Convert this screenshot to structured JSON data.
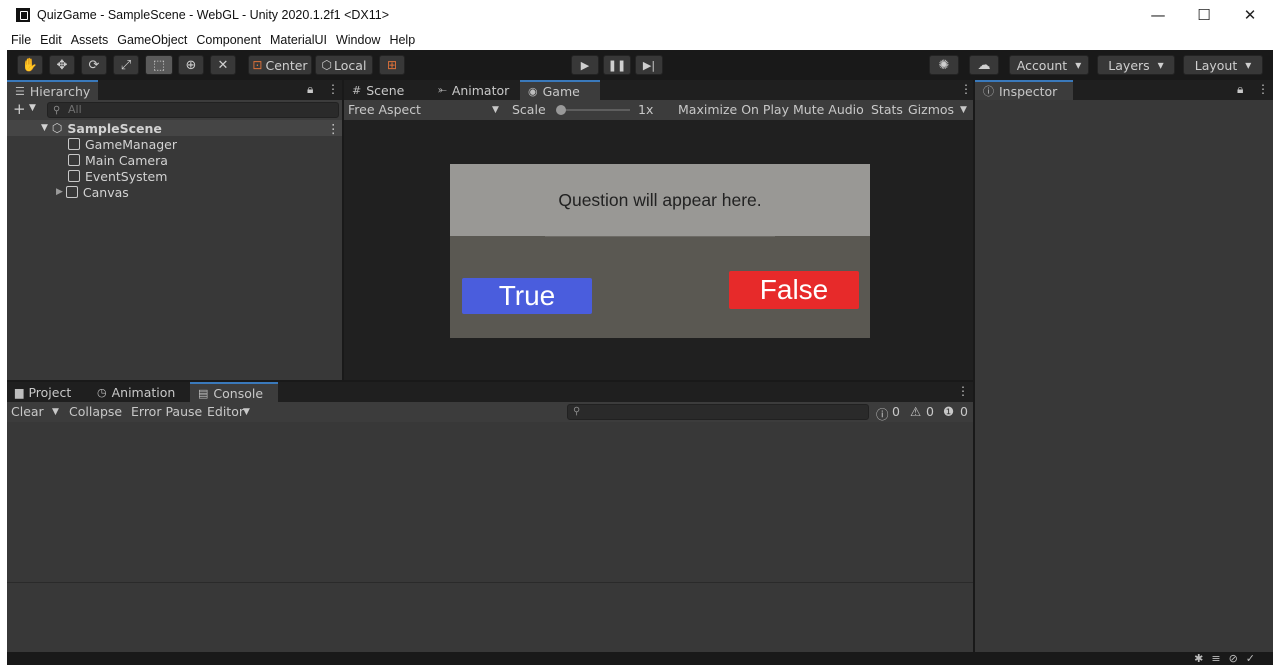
{
  "window": {
    "title": "QuizGame - SampleScene - WebGL - Unity 2020.1.2f1 <DX11>",
    "minimize": "—",
    "maximize": "☐",
    "close": "✕"
  },
  "menu": [
    "File",
    "Edit",
    "Assets",
    "GameObject",
    "Component",
    "MaterialUI",
    "Window",
    "Help"
  ],
  "toolbar": {
    "pivot": "Center",
    "space": "Local",
    "account": "Account",
    "layers": "Layers",
    "layout": "Layout"
  },
  "hierarchy": {
    "title": "Hierarchy",
    "search_placeholder": "All",
    "scene": "SampleScene",
    "items": [
      "GameManager",
      "Main Camera",
      "EventSystem",
      "Canvas"
    ]
  },
  "center_tabs": [
    "Scene",
    "Animator",
    "Game"
  ],
  "game_toolbar": {
    "aspect": "Free Aspect",
    "scale_label": "Scale",
    "scale_value": "1x",
    "maximize": "Maximize On Play",
    "mute": "Mute Audio",
    "stats": "Stats",
    "gizmos": "Gizmos"
  },
  "game": {
    "question": "Question will appear here.",
    "true_label": "True",
    "false_label": "False",
    "colors": {
      "true": "#4a5ddd",
      "false": "#e72a2a"
    }
  },
  "inspector": {
    "title": "Inspector"
  },
  "bottom_tabs": [
    "Project",
    "Animation",
    "Console"
  ],
  "console": {
    "clear": "Clear",
    "collapse": "Collapse",
    "error_pause": "Error Pause",
    "editor": "Editor",
    "count_log": "0",
    "count_warn": "0",
    "count_error": "0"
  },
  "accent": "#3a79bb"
}
